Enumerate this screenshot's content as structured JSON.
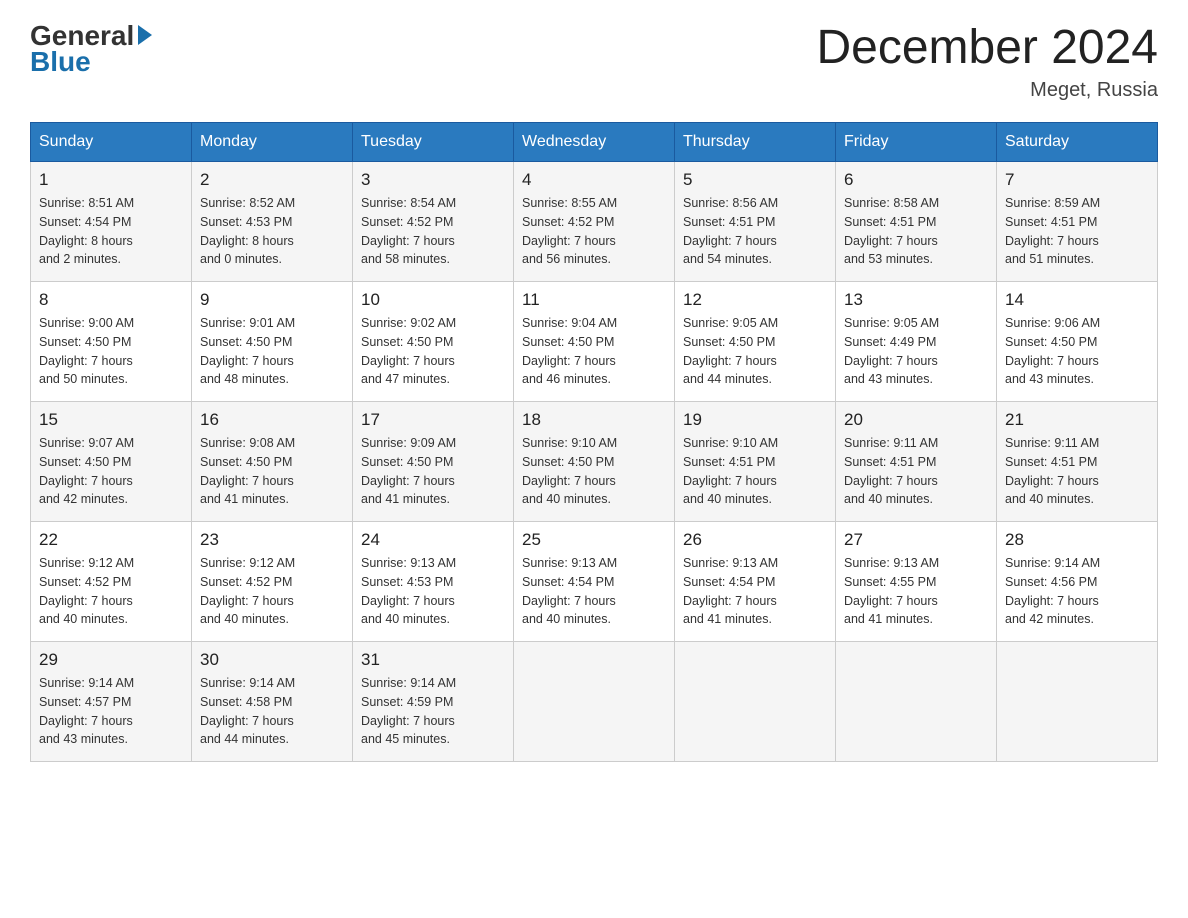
{
  "header": {
    "logo_general": "General",
    "logo_blue": "Blue",
    "month_year": "December 2024",
    "location": "Meget, Russia"
  },
  "days_of_week": [
    "Sunday",
    "Monday",
    "Tuesday",
    "Wednesday",
    "Thursday",
    "Friday",
    "Saturday"
  ],
  "weeks": [
    [
      {
        "day": "1",
        "info": "Sunrise: 8:51 AM\nSunset: 4:54 PM\nDaylight: 8 hours\nand 2 minutes."
      },
      {
        "day": "2",
        "info": "Sunrise: 8:52 AM\nSunset: 4:53 PM\nDaylight: 8 hours\nand 0 minutes."
      },
      {
        "day": "3",
        "info": "Sunrise: 8:54 AM\nSunset: 4:52 PM\nDaylight: 7 hours\nand 58 minutes."
      },
      {
        "day": "4",
        "info": "Sunrise: 8:55 AM\nSunset: 4:52 PM\nDaylight: 7 hours\nand 56 minutes."
      },
      {
        "day": "5",
        "info": "Sunrise: 8:56 AM\nSunset: 4:51 PM\nDaylight: 7 hours\nand 54 minutes."
      },
      {
        "day": "6",
        "info": "Sunrise: 8:58 AM\nSunset: 4:51 PM\nDaylight: 7 hours\nand 53 minutes."
      },
      {
        "day": "7",
        "info": "Sunrise: 8:59 AM\nSunset: 4:51 PM\nDaylight: 7 hours\nand 51 minutes."
      }
    ],
    [
      {
        "day": "8",
        "info": "Sunrise: 9:00 AM\nSunset: 4:50 PM\nDaylight: 7 hours\nand 50 minutes."
      },
      {
        "day": "9",
        "info": "Sunrise: 9:01 AM\nSunset: 4:50 PM\nDaylight: 7 hours\nand 48 minutes."
      },
      {
        "day": "10",
        "info": "Sunrise: 9:02 AM\nSunset: 4:50 PM\nDaylight: 7 hours\nand 47 minutes."
      },
      {
        "day": "11",
        "info": "Sunrise: 9:04 AM\nSunset: 4:50 PM\nDaylight: 7 hours\nand 46 minutes."
      },
      {
        "day": "12",
        "info": "Sunrise: 9:05 AM\nSunset: 4:50 PM\nDaylight: 7 hours\nand 44 minutes."
      },
      {
        "day": "13",
        "info": "Sunrise: 9:05 AM\nSunset: 4:49 PM\nDaylight: 7 hours\nand 43 minutes."
      },
      {
        "day": "14",
        "info": "Sunrise: 9:06 AM\nSunset: 4:50 PM\nDaylight: 7 hours\nand 43 minutes."
      }
    ],
    [
      {
        "day": "15",
        "info": "Sunrise: 9:07 AM\nSunset: 4:50 PM\nDaylight: 7 hours\nand 42 minutes."
      },
      {
        "day": "16",
        "info": "Sunrise: 9:08 AM\nSunset: 4:50 PM\nDaylight: 7 hours\nand 41 minutes."
      },
      {
        "day": "17",
        "info": "Sunrise: 9:09 AM\nSunset: 4:50 PM\nDaylight: 7 hours\nand 41 minutes."
      },
      {
        "day": "18",
        "info": "Sunrise: 9:10 AM\nSunset: 4:50 PM\nDaylight: 7 hours\nand 40 minutes."
      },
      {
        "day": "19",
        "info": "Sunrise: 9:10 AM\nSunset: 4:51 PM\nDaylight: 7 hours\nand 40 minutes."
      },
      {
        "day": "20",
        "info": "Sunrise: 9:11 AM\nSunset: 4:51 PM\nDaylight: 7 hours\nand 40 minutes."
      },
      {
        "day": "21",
        "info": "Sunrise: 9:11 AM\nSunset: 4:51 PM\nDaylight: 7 hours\nand 40 minutes."
      }
    ],
    [
      {
        "day": "22",
        "info": "Sunrise: 9:12 AM\nSunset: 4:52 PM\nDaylight: 7 hours\nand 40 minutes."
      },
      {
        "day": "23",
        "info": "Sunrise: 9:12 AM\nSunset: 4:52 PM\nDaylight: 7 hours\nand 40 minutes."
      },
      {
        "day": "24",
        "info": "Sunrise: 9:13 AM\nSunset: 4:53 PM\nDaylight: 7 hours\nand 40 minutes."
      },
      {
        "day": "25",
        "info": "Sunrise: 9:13 AM\nSunset: 4:54 PM\nDaylight: 7 hours\nand 40 minutes."
      },
      {
        "day": "26",
        "info": "Sunrise: 9:13 AM\nSunset: 4:54 PM\nDaylight: 7 hours\nand 41 minutes."
      },
      {
        "day": "27",
        "info": "Sunrise: 9:13 AM\nSunset: 4:55 PM\nDaylight: 7 hours\nand 41 minutes."
      },
      {
        "day": "28",
        "info": "Sunrise: 9:14 AM\nSunset: 4:56 PM\nDaylight: 7 hours\nand 42 minutes."
      }
    ],
    [
      {
        "day": "29",
        "info": "Sunrise: 9:14 AM\nSunset: 4:57 PM\nDaylight: 7 hours\nand 43 minutes."
      },
      {
        "day": "30",
        "info": "Sunrise: 9:14 AM\nSunset: 4:58 PM\nDaylight: 7 hours\nand 44 minutes."
      },
      {
        "day": "31",
        "info": "Sunrise: 9:14 AM\nSunset: 4:59 PM\nDaylight: 7 hours\nand 45 minutes."
      },
      {
        "day": "",
        "info": ""
      },
      {
        "day": "",
        "info": ""
      },
      {
        "day": "",
        "info": ""
      },
      {
        "day": "",
        "info": ""
      }
    ]
  ]
}
